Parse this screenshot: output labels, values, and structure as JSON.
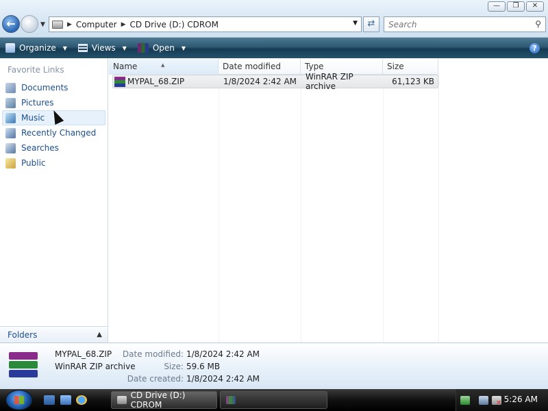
{
  "window": {
    "minimize_icon": "minimize-icon",
    "maximize_icon": "maximize-icon",
    "close_icon": "close-icon"
  },
  "address": {
    "crumbs": [
      "Computer",
      "CD Drive (D:) CDROM"
    ]
  },
  "search": {
    "placeholder": "Search"
  },
  "toolbar": {
    "organize_label": "Organize",
    "views_label": "Views",
    "open_label": "Open"
  },
  "nav": {
    "header": "Favorite Links",
    "items": [
      {
        "label": "Documents",
        "icon": "documents-icon"
      },
      {
        "label": "Pictures",
        "icon": "pictures-icon"
      },
      {
        "label": "Music",
        "icon": "music-icon"
      },
      {
        "label": "Recently Changed",
        "icon": "recently-changed-icon"
      },
      {
        "label": "Searches",
        "icon": "searches-icon"
      },
      {
        "label": "Public",
        "icon": "public-folder-icon"
      }
    ],
    "folders_label": "Folders"
  },
  "columns": [
    "Name",
    "Date modified",
    "Type",
    "Size"
  ],
  "files": [
    {
      "name": "MYPAL_68.ZIP",
      "date_modified": "1/8/2024 2:42 AM",
      "type": "WinRAR ZIP archive",
      "size": "61,123 KB"
    }
  ],
  "details": {
    "name": "MYPAL_68.ZIP",
    "type": "WinRAR ZIP archive",
    "date_modified_label": "Date modified:",
    "date_modified": "1/8/2024 2:42 AM",
    "size_label": "Size:",
    "size": "59.6 MB",
    "date_created_label": "Date created:",
    "date_created": "1/8/2024 2:42 AM"
  },
  "taskbar": {
    "active_window": "CD Drive (D:) CDROM",
    "clock": "5:26 AM"
  },
  "colors": {
    "command_bar": "#2d5873",
    "link_text": "#1b4e8e",
    "taskbar": "#111111"
  }
}
